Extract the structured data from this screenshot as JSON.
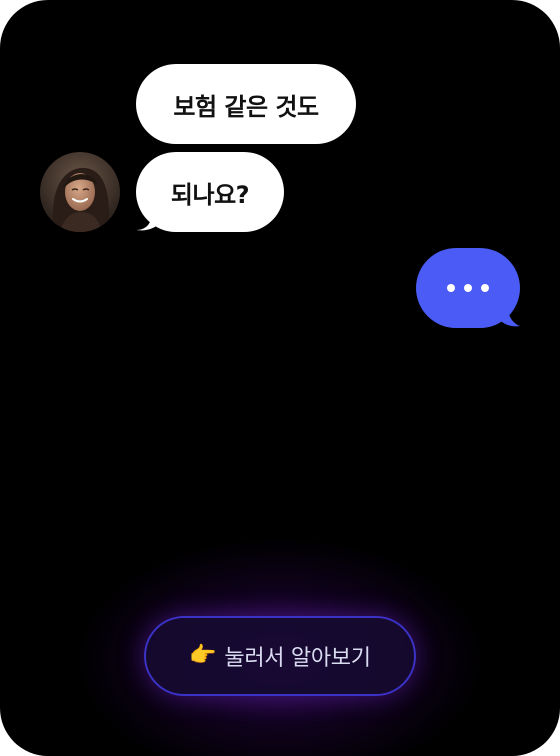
{
  "chat": {
    "incoming": {
      "line1": "보험 같은 것도",
      "line2": "되나요?"
    },
    "avatar_icon": "woman-avatar",
    "typing_indicator": "...",
    "colors": {
      "background": "#000000",
      "incoming_bubble": "#ffffff",
      "outgoing_bubble": "#4a5cf5"
    }
  },
  "cta": {
    "emoji": "👉",
    "label": "눌러서 알아보기",
    "border_color": "#3b32c6"
  }
}
